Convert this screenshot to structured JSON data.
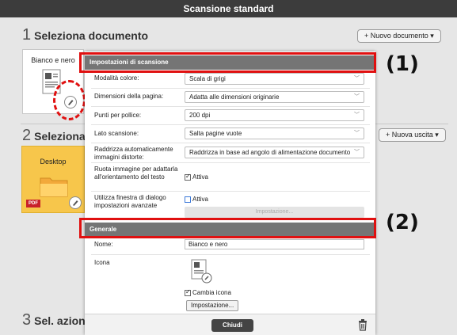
{
  "window": {
    "title": "Scansione standard"
  },
  "sections": {
    "s1": {
      "number": "1",
      "title": "Seleziona documento",
      "button": "+ Nuovo documento ▾",
      "card_label": "Bianco e nero"
    },
    "s2": {
      "number": "2",
      "title": "Seleziona",
      "button": "+ Nuova uscita ▾",
      "card_label": "Desktop",
      "badge": "PDF"
    },
    "s3": {
      "number": "3",
      "title": "Sel. azion"
    }
  },
  "panel": {
    "header_scan": "Impostazioni di scansione",
    "rows": [
      {
        "label": "Modalità colore:",
        "value": "Scala di grigi"
      },
      {
        "label": "Dimensioni della pagina:",
        "value": "Adatta alle dimensioni originarie"
      },
      {
        "label": "Punti per pollice:",
        "value": "200 dpi"
      },
      {
        "label": "Lato scansione:",
        "value": "Salta pagine vuote"
      },
      {
        "label": "Raddrizza automaticamente immagini distorte:",
        "value": "Raddrizza in base ad angolo di alimentazione documento"
      }
    ],
    "rotate_label": "Ruota immagine per adattarla all'orientamento del testo",
    "rotate_check": "Attiva",
    "advanced_label": "Utilizza finestra di dialogo impostazioni avanzate",
    "advanced_check": "Attiva",
    "advanced_button": "Impostazione...",
    "header_general": "Generale",
    "name_label": "Nome:",
    "name_value": "Bianco e nero",
    "icon_label": "Icona",
    "change_icon": "Cambia icona",
    "icon_settings": "Impostazione...",
    "close": "Chiudi"
  },
  "callouts": {
    "c1": "(1)",
    "c2": "(2)"
  },
  "colors": {
    "titlebar": "#3c3c3c",
    "header": "#757575",
    "highlight": "#e01010",
    "card_yellow": "#f7c64b"
  },
  "icons": [
    "pencil-icon",
    "trash-icon",
    "folder-icon",
    "document-icon",
    "chevron-down-icon"
  ]
}
